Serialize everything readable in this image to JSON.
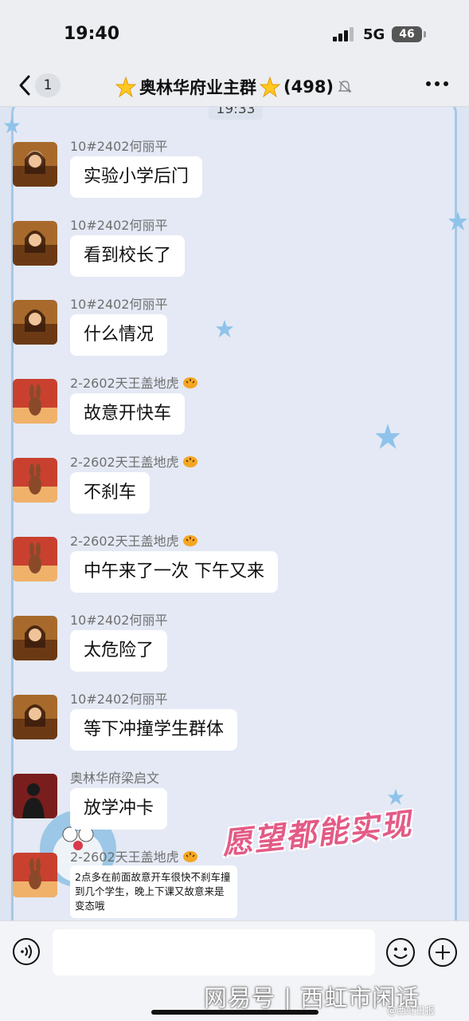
{
  "status_bar": {
    "time": "19:40",
    "network": "5G",
    "battery": "46"
  },
  "header": {
    "back_badge": "1",
    "group_name": "奥林华府业主群",
    "member_count": "(498)",
    "icons": [
      "back-icon",
      "star-emoji",
      "mute-bell-icon",
      "more-icon"
    ]
  },
  "chat": {
    "time_divider": "19:33",
    "messages": [
      {
        "sender": "10#2402何丽平",
        "text": "实验小学后门",
        "avatar": "woman-portrait"
      },
      {
        "sender": "10#2402何丽平",
        "text": "看到校长了",
        "avatar": "woman-portrait"
      },
      {
        "sender": "10#2402何丽平",
        "text": "什么情况",
        "avatar": "woman-portrait"
      },
      {
        "sender": "2-2602天王盖地虎",
        "text": "故意开快车",
        "avatar": "rabbit-art"
      },
      {
        "sender": "2-2602天王盖地虎",
        "text": "不刹车",
        "avatar": "rabbit-art"
      },
      {
        "sender": "2-2602天王盖地虎",
        "text": "中午来了一次 下午又来",
        "avatar": "rabbit-art"
      },
      {
        "sender": "10#2402何丽平",
        "text": "太危险了",
        "avatar": "woman-portrait"
      },
      {
        "sender": "10#2402何丽平",
        "text": "等下冲撞学生群体",
        "avatar": "woman-portrait"
      },
      {
        "sender": "奥林华府梁启文",
        "text": "放学冲卡",
        "avatar": "dark-silhouette"
      },
      {
        "sender": "2-2602天王盖地虎",
        "text": "2点多在前面故意开车很快不刹车撞到几个学生，晚上下课又故意来是变态哦",
        "avatar": "rabbit-art"
      }
    ],
    "sticker_text": "愿望都能实现"
  },
  "input_bar": {
    "placeholder": "",
    "icons": [
      "voice-icon",
      "emoji-icon",
      "plus-icon"
    ]
  },
  "watermark": {
    "main": "网易号 | 西虹市闲话",
    "sub": "@西虹日报"
  },
  "colors": {
    "chat_bg": "#dde4f2",
    "bubble": "#ffffff",
    "frame": "#a6c7e7",
    "sticker": "#e35b86"
  }
}
